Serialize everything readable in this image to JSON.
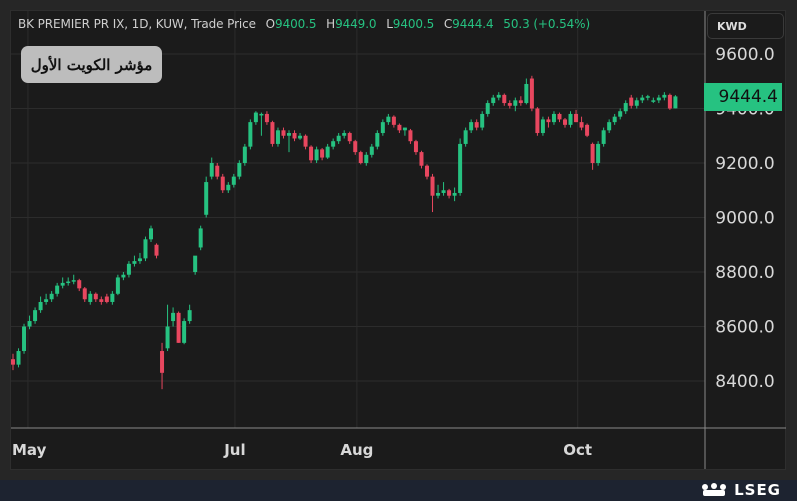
{
  "legend": {
    "symbol": "BK PREMIER PR IX, 1D, KUW, Trade Price",
    "open_label": "O",
    "open": "9400.5",
    "high_label": "H",
    "high": "9449.0",
    "low_label": "L",
    "low": "9400.5",
    "close_label": "C",
    "close": "9444.4",
    "change": "50.3 (+0.54%)"
  },
  "index_name_ar": "مؤشر الكويت الأول",
  "currency": "KWD",
  "last_price": "9444.4",
  "brand": "LSEG",
  "colors": {
    "up": "#26c281",
    "down": "#e8475f",
    "background": "#1b1b1b",
    "grid": "#2c2c2c"
  },
  "chart_data": {
    "type": "candlestick",
    "title": "BK PREMIER PR IX, 1D, KUW, Trade Price",
    "ylabel": "KWD",
    "ylim": [
      8280,
      9780
    ],
    "grid": true,
    "y_ticks": [
      "9600.0",
      "9400.0",
      "9200.0",
      "9000.0",
      "8800.0",
      "8600.0",
      "8400.0"
    ],
    "x_ticks": [
      {
        "label": "May",
        "index": 2.7
      },
      {
        "label": "Jul",
        "index": 40.2
      },
      {
        "label": "Aug",
        "index": 62.3
      },
      {
        "label": "Oct",
        "index": 102.3
      }
    ],
    "candles_ohlc": [
      [
        8480,
        8500,
        8440,
        8460
      ],
      [
        8460,
        8520,
        8450,
        8510
      ],
      [
        8510,
        8610,
        8500,
        8600
      ],
      [
        8600,
        8640,
        8590,
        8620
      ],
      [
        8620,
        8670,
        8610,
        8660
      ],
      [
        8660,
        8710,
        8650,
        8690
      ],
      [
        8690,
        8720,
        8680,
        8700
      ],
      [
        8700,
        8730,
        8690,
        8720
      ],
      [
        8720,
        8760,
        8710,
        8750
      ],
      [
        8750,
        8780,
        8740,
        8760
      ],
      [
        8760,
        8780,
        8750,
        8765
      ],
      [
        8765,
        8790,
        8755,
        8770
      ],
      [
        8770,
        8775,
        8730,
        8740
      ],
      [
        8740,
        8745,
        8690,
        8700
      ],
      [
        8690,
        8730,
        8680,
        8720
      ],
      [
        8720,
        8725,
        8690,
        8700
      ],
      [
        8700,
        8710,
        8680,
        8690
      ],
      [
        8710,
        8720,
        8685,
        8690
      ],
      [
        8690,
        8730,
        8680,
        8720
      ],
      [
        8720,
        8790,
        8715,
        8780
      ],
      [
        8780,
        8800,
        8770,
        8790
      ],
      [
        8790,
        8840,
        8780,
        8830
      ],
      [
        8830,
        8860,
        8820,
        8840
      ],
      [
        8840,
        8870,
        8830,
        8850
      ],
      [
        8850,
        8930,
        8840,
        8920
      ],
      [
        8920,
        8970,
        8910,
        8960
      ],
      [
        8900,
        8905,
        8850,
        8860
      ],
      [
        8510,
        8540,
        8370,
        8430
      ],
      [
        8520,
        8680,
        8510,
        8600
      ],
      [
        8620,
        8670,
        8600,
        8650
      ],
      [
        8650,
        8655,
        8540,
        8540
      ],
      [
        8540,
        8630,
        8535,
        8620
      ],
      [
        8620,
        8680,
        8610,
        8660
      ],
      [
        8800,
        8830,
        8790,
        8860
      ],
      [
        8890,
        8970,
        8880,
        8960
      ],
      [
        9010,
        9150,
        9000,
        9130
      ],
      [
        9150,
        9220,
        9140,
        9200
      ],
      [
        9190,
        9200,
        9140,
        9150
      ],
      [
        9150,
        9160,
        9090,
        9100
      ],
      [
        9100,
        9130,
        9090,
        9120
      ],
      [
        9120,
        9160,
        9110,
        9150
      ],
      [
        9150,
        9210,
        9140,
        9200
      ],
      [
        9200,
        9270,
        9190,
        9260
      ],
      [
        9260,
        9360,
        9250,
        9350
      ],
      [
        9350,
        9390,
        9340,
        9385
      ],
      [
        9380,
        9385,
        9300,
        9380
      ],
      [
        9380,
        9390,
        9340,
        9350
      ],
      [
        9350,
        9355,
        9260,
        9270
      ],
      [
        9270,
        9330,
        9260,
        9320
      ],
      [
        9320,
        9330,
        9290,
        9300
      ],
      [
        9300,
        9320,
        9240,
        9310
      ],
      [
        9310,
        9320,
        9280,
        9290
      ],
      [
        9290,
        9310,
        9285,
        9300
      ],
      [
        9300,
        9305,
        9250,
        9260
      ],
      [
        9260,
        9265,
        9200,
        9210
      ],
      [
        9210,
        9260,
        9200,
        9250
      ],
      [
        9250,
        9255,
        9210,
        9220
      ],
      [
        9220,
        9270,
        9215,
        9260
      ],
      [
        9260,
        9290,
        9250,
        9280
      ],
      [
        9280,
        9310,
        9270,
        9300
      ],
      [
        9300,
        9320,
        9290,
        9310
      ],
      [
        9310,
        9315,
        9270,
        9280
      ],
      [
        9280,
        9285,
        9230,
        9240
      ],
      [
        9240,
        9245,
        9195,
        9200
      ],
      [
        9200,
        9240,
        9190,
        9230
      ],
      [
        9230,
        9270,
        9220,
        9260
      ],
      [
        9260,
        9320,
        9250,
        9310
      ],
      [
        9310,
        9360,
        9300,
        9350
      ],
      [
        9350,
        9380,
        9340,
        9370
      ],
      [
        9370,
        9375,
        9330,
        9340
      ],
      [
        9340,
        9345,
        9310,
        9320
      ],
      [
        9320,
        9330,
        9300,
        9330
      ],
      [
        9320,
        9325,
        9270,
        9280
      ],
      [
        9280,
        9285,
        9230,
        9240
      ],
      [
        9240,
        9245,
        9180,
        9190
      ],
      [
        9190,
        9195,
        9140,
        9150
      ],
      [
        9150,
        9160,
        9020,
        9080
      ],
      [
        9080,
        9120,
        9070,
        9090
      ],
      [
        9090,
        9130,
        9080,
        9100
      ],
      [
        9100,
        9105,
        9070,
        9080
      ],
      [
        9080,
        9110,
        9060,
        9090
      ],
      [
        9090,
        9290,
        9080,
        9270
      ],
      [
        9270,
        9330,
        9260,
        9320
      ],
      [
        9320,
        9360,
        9310,
        9350
      ],
      [
        9350,
        9360,
        9320,
        9330
      ],
      [
        9330,
        9390,
        9320,
        9380
      ],
      [
        9380,
        9430,
        9370,
        9420
      ],
      [
        9420,
        9450,
        9410,
        9440
      ],
      [
        9440,
        9460,
        9430,
        9450
      ],
      [
        9450,
        9455,
        9410,
        9420
      ],
      [
        9420,
        9430,
        9400,
        9410
      ],
      [
        9410,
        9440,
        9390,
        9430
      ],
      [
        9430,
        9445,
        9410,
        9420
      ],
      [
        9420,
        9510,
        9415,
        9490
      ],
      [
        9510,
        9520,
        9390,
        9400
      ],
      [
        9400,
        9405,
        9300,
        9310
      ],
      [
        9310,
        9370,
        9300,
        9360
      ],
      [
        9360,
        9370,
        9330,
        9350
      ],
      [
        9350,
        9390,
        9340,
        9380
      ],
      [
        9380,
        9385,
        9350,
        9360
      ],
      [
        9360,
        9365,
        9330,
        9340
      ],
      [
        9340,
        9390,
        9330,
        9380
      ],
      [
        9380,
        9395,
        9350,
        9350
      ],
      [
        9350,
        9370,
        9320,
        9330
      ],
      [
        9340,
        9345,
        9295,
        9300
      ],
      [
        9270,
        9275,
        9175,
        9200
      ],
      [
        9200,
        9280,
        9190,
        9270
      ],
      [
        9270,
        9330,
        9260,
        9320
      ],
      [
        9320,
        9360,
        9310,
        9350
      ],
      [
        9350,
        9380,
        9340,
        9370
      ],
      [
        9370,
        9400,
        9360,
        9390
      ],
      [
        9390,
        9430,
        9380,
        9420
      ],
      [
        9440,
        9450,
        9400,
        9410
      ],
      [
        9410,
        9440,
        9400,
        9430
      ],
      [
        9430,
        9450,
        9420,
        9440
      ],
      [
        9440,
        9450,
        9430,
        9445
      ],
      [
        9430,
        9440,
        9420,
        9430
      ],
      [
        9430,
        9450,
        9420,
        9440
      ],
      [
        9440,
        9460,
        9430,
        9450
      ],
      [
        9450,
        9455,
        9395,
        9400
      ],
      [
        9400.5,
        9449,
        9400.5,
        9444.4
      ]
    ]
  }
}
